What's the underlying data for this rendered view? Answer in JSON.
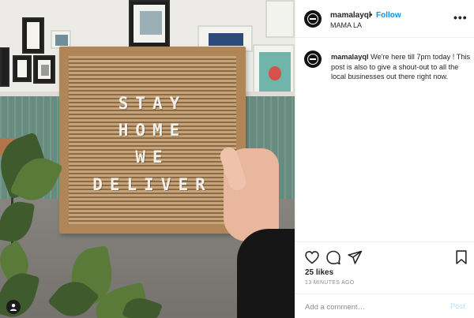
{
  "post": {
    "username": "mamalayql",
    "follow_separator": "•",
    "follow_label": "Follow",
    "location": "MAMA LA",
    "more_icon": "more-horizontal-icon",
    "caption_username": "mamalayql",
    "caption_text": "We're here till 7pm today ! This post is also to give a shout-out to all the local businesses out there right now.",
    "likes": "25 likes",
    "timestamp": "13 MINUTES AGO",
    "comment_placeholder": "Add a comment…",
    "post_label": "Post"
  },
  "photo": {
    "board_lines": [
      "STAY",
      "HOME",
      "WE",
      "DELIVER"
    ]
  },
  "icons": {
    "like": "heart-icon",
    "comment": "comment-icon",
    "share": "paper-plane-icon",
    "save": "bookmark-icon",
    "user_tag": "user-tag-icon"
  },
  "colors": {
    "accent": "#0095f6",
    "post_disabled": "#b2dffc",
    "text": "#262626",
    "muted": "#8e8e8e"
  }
}
